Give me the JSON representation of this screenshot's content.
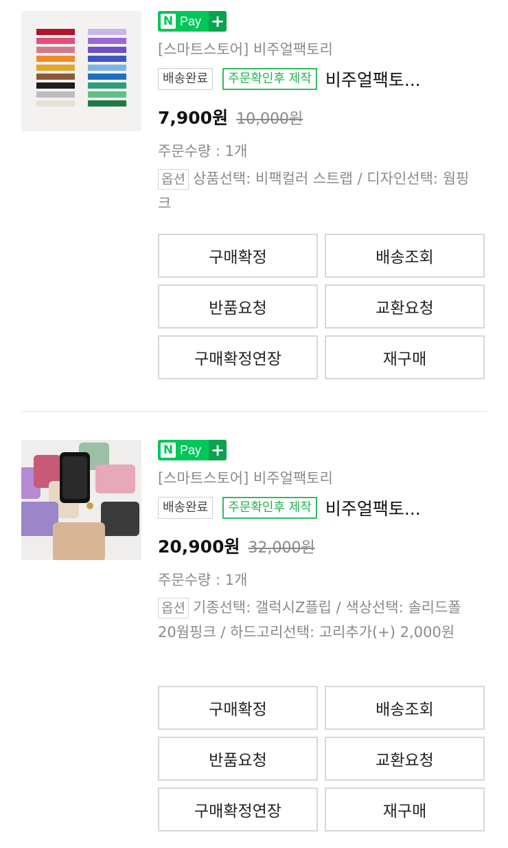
{
  "orders": [
    {
      "npay_label": "Pay",
      "npay_n": "N",
      "npay_plus": "+",
      "store": "[스마트스토어] 비주얼팩토리",
      "tag_status": "배송완료",
      "tag_made": "주문확인후 제작",
      "title": "비주얼팩토...",
      "price": "7,900원",
      "original_price": "10,000원",
      "quantity": "주문수량 : 1개",
      "option_badge": "옵션",
      "option_text": "상품선택: 비팩컬러 스트랩 / 디자인선택: 웜핑크",
      "buttons": [
        "구매확정",
        "배송조회",
        "반품요청",
        "교환요청",
        "구매확정연장",
        "재구매"
      ]
    },
    {
      "npay_label": "Pay",
      "npay_n": "N",
      "npay_plus": "+",
      "store": "[스마트스토어] 비주얼팩토리",
      "tag_status": "배송완료",
      "tag_made": "주문확인후 제작",
      "title": "비주얼팩토...",
      "price": "20,900원",
      "original_price": "32,000원",
      "quantity": "주문수량 : 1개",
      "option_badge": "옵션",
      "option_text": "기종선택: 갤럭시Z플립 / 색상선택: 솔리드폴 20웜핑크 / 하드고리선택: 고리추가(+) 2,000원",
      "buttons": [
        "구매확정",
        "배송조회",
        "반품요청",
        "교환요청",
        "구매확정연장",
        "재구매"
      ]
    }
  ],
  "colors": {
    "npay_green": "#03c75a",
    "tag_green": "#22b34f",
    "muted_text": "#8a8a8a",
    "button_border": "#d8d8d8"
  }
}
